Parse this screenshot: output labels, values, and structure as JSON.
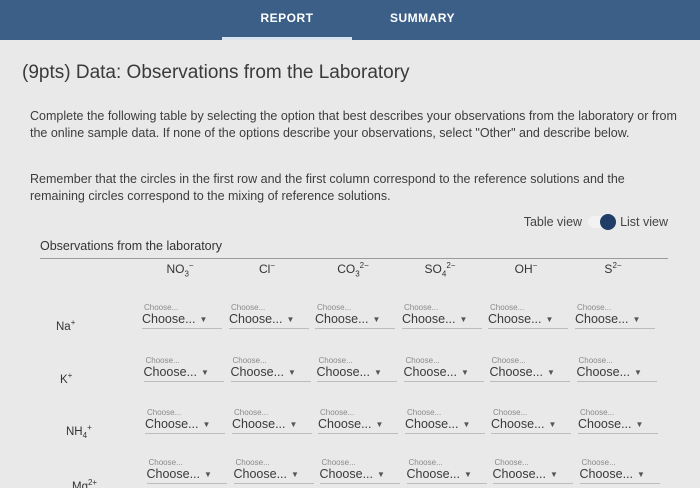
{
  "tabs": {
    "report": "REPORT",
    "summary": "SUMMARY"
  },
  "title": "(9pts) Data: Observations from the Laboratory",
  "instructions": {
    "p1": "Complete the following table by selecting the option that best describes your observations from the laboratory or from the online sample data. If none of the options describe your observations, select \"Other\" and describe below.",
    "p2": "Remember that the circles in the first row and the first column correspond to the reference solutions and the remaining circles correspond to the mixing of reference solutions."
  },
  "view_toggle": {
    "left_label": "Table view",
    "right_label": "List view"
  },
  "table": {
    "label": "Observations from the laboratory",
    "columns": [
      {
        "base": "NO",
        "sub": "3",
        "sup": "−"
      },
      {
        "base": "Cl",
        "sub": "",
        "sup": "−"
      },
      {
        "base": "CO",
        "sub": "3",
        "sup": "2−"
      },
      {
        "base": "SO",
        "sub": "4",
        "sup": "2−"
      },
      {
        "base": "OH",
        "sub": "",
        "sup": "−"
      },
      {
        "base": "S",
        "sub": "",
        "sup": "2−"
      }
    ],
    "rows": [
      {
        "base": "Na",
        "sub": "",
        "sup": "+"
      },
      {
        "base": "K",
        "sub": "",
        "sup": "+"
      },
      {
        "base": "NH",
        "sub": "4",
        "sup": "+"
      },
      {
        "base": "Mg",
        "sub": "",
        "sup": "2+"
      }
    ],
    "cell_hint": "Choose...",
    "cell_value": "Choose..."
  }
}
